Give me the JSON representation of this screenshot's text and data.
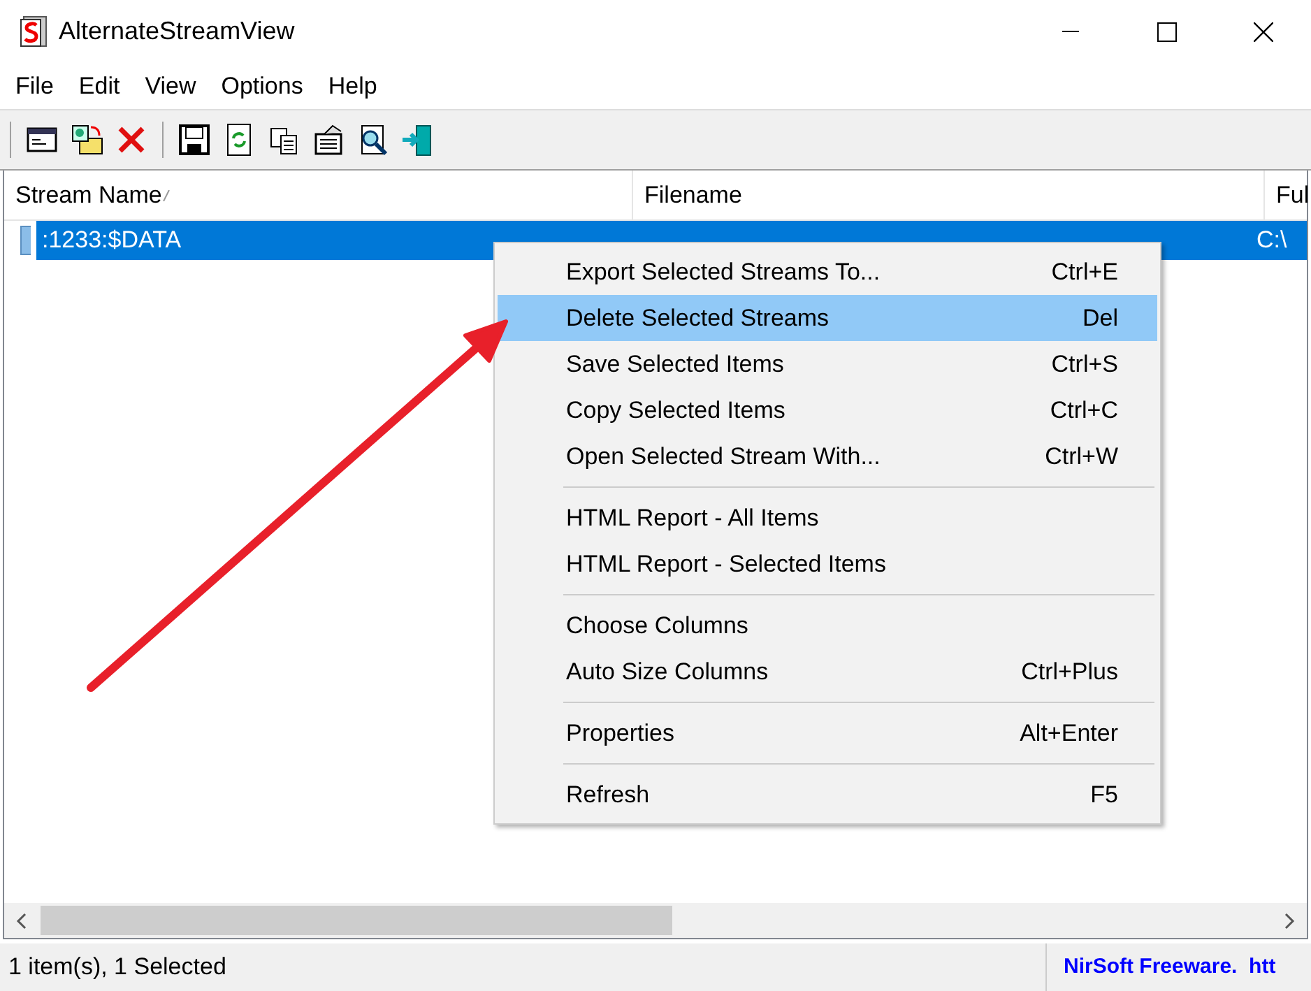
{
  "window": {
    "title": "AlternateStreamView"
  },
  "menu_bar": [
    "File",
    "Edit",
    "View",
    "Options",
    "Help"
  ],
  "toolbar": [
    {
      "kind": "properties"
    },
    {
      "kind": "open"
    },
    {
      "kind": "delete"
    },
    {
      "kind": "separator"
    },
    {
      "kind": "save"
    },
    {
      "kind": "refresh"
    },
    {
      "kind": "copy"
    },
    {
      "kind": "report"
    },
    {
      "kind": "find"
    },
    {
      "kind": "exit"
    }
  ],
  "table": {
    "columns": [
      "Stream Name",
      "Filename",
      "Ful"
    ],
    "rows": [
      {
        "selected": true,
        "stream_name": ":1233:$DATA",
        "column_3": "C:\\"
      }
    ]
  },
  "context_menu": [
    {
      "kind": "item",
      "label": "Export Selected Streams To...",
      "shortcut": "Ctrl+E",
      "selected": false
    },
    {
      "kind": "item",
      "label": "Delete Selected Streams",
      "shortcut": "Del",
      "selected": true
    },
    {
      "kind": "item",
      "label": "Save Selected Items",
      "shortcut": "Ctrl+S",
      "selected": false
    },
    {
      "kind": "item",
      "label": "Copy Selected Items",
      "shortcut": "Ctrl+C",
      "selected": false
    },
    {
      "kind": "item",
      "label": "Open Selected Stream With...",
      "shortcut": "Ctrl+W",
      "selected": false
    },
    {
      "kind": "separator"
    },
    {
      "kind": "item",
      "label": "HTML Report - All Items",
      "selected": false
    },
    {
      "kind": "item",
      "label": "HTML Report - Selected Items",
      "selected": false
    },
    {
      "kind": "separator"
    },
    {
      "kind": "item",
      "label": "Choose Columns",
      "selected": false
    },
    {
      "kind": "item",
      "label": "Auto Size Columns",
      "shortcut": "Ctrl+Plus",
      "selected": false
    },
    {
      "kind": "separator"
    },
    {
      "kind": "item",
      "label": "Properties",
      "shortcut": "Alt+Enter",
      "selected": false
    },
    {
      "kind": "separator"
    },
    {
      "kind": "item",
      "label": "Refresh",
      "shortcut": "F5",
      "selected": false
    }
  ],
  "status_bar": [
    "1 item(s), 1 Selected",
    "NirSoft Freeware.  htt"
  ]
}
